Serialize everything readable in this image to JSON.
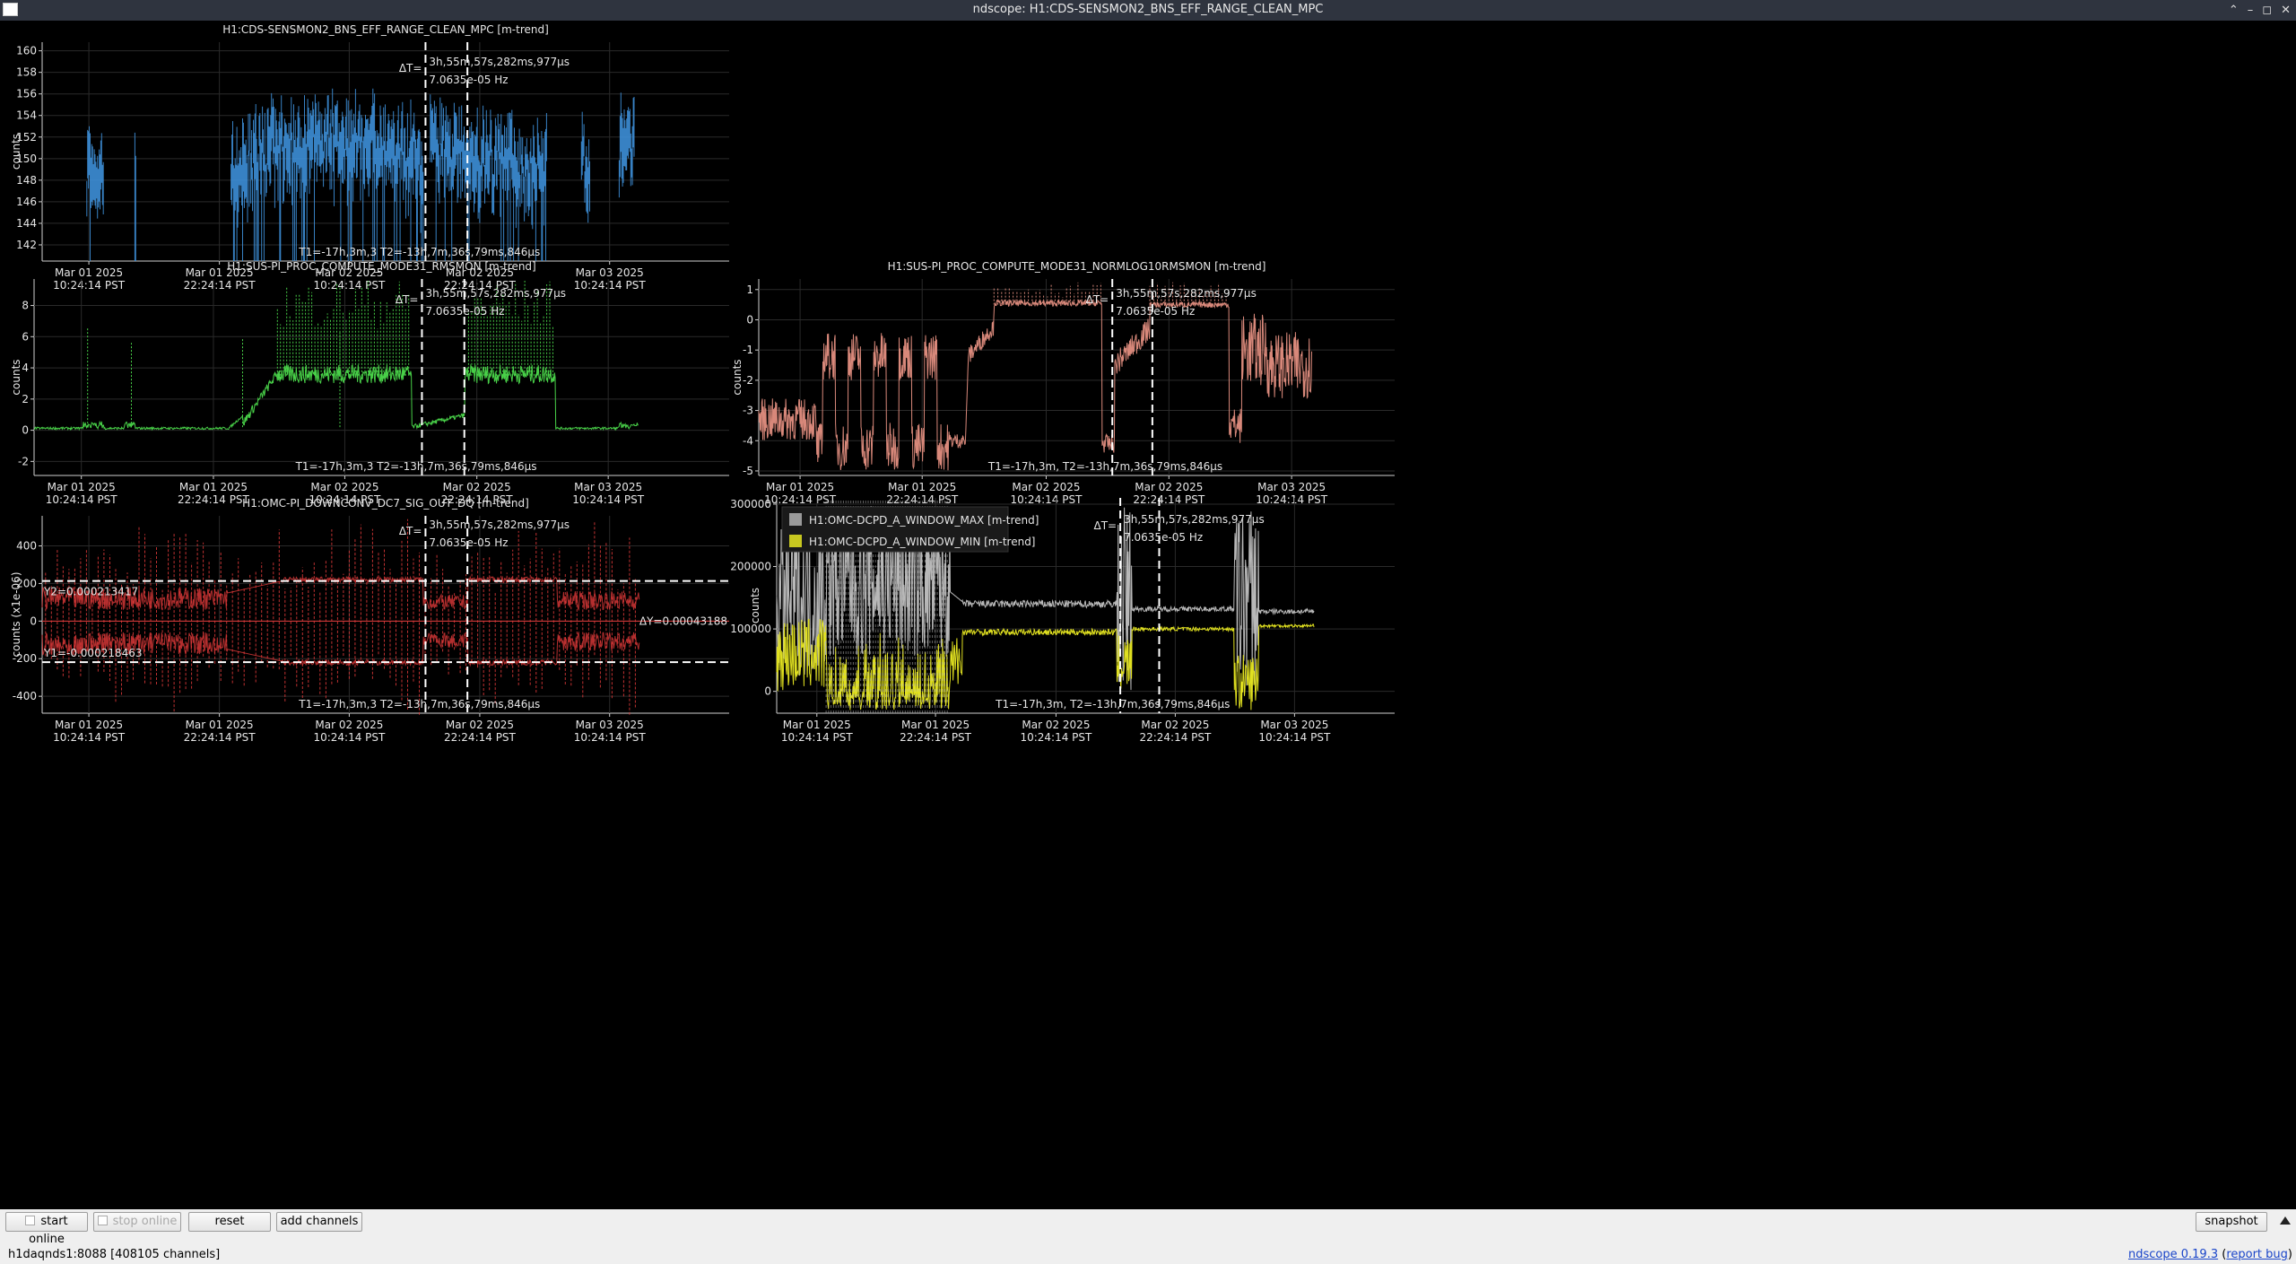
{
  "window": {
    "title": "ndscope: H1:CDS-SENSMON2_BNS_EFF_RANGE_CLEAN_MPC",
    "controls": [
      "⌃",
      "–",
      "◻",
      "✕"
    ]
  },
  "colors": {
    "blue": "#3d8fd8",
    "green": "#48d048",
    "salmon": "#d8887a",
    "red": "#e03a3a",
    "gray": "#b8b8b8",
    "yellow": "#e0e020",
    "cursor": "#ffffff"
  },
  "cursors": {
    "dt": "3h,55m,57s,282ms,977μs",
    "freq": "7.0635e-05 Hz",
    "dt_label": "ΔT=",
    "t_readout": "T1=-17h,3m,3 T2=-13h,7m,36s,79ms,846μs",
    "t_readout_short": "T1=-17h,3m, T2=-13h,7m,36s,79ms,846μs"
  },
  "time_ticks": [
    {
      "date": "Mar 01 2025",
      "time": "10:24:14 PST"
    },
    {
      "date": "Mar 01 2025",
      "time": "22:24:14 PST"
    },
    {
      "date": "Mar 02 2025",
      "time": "10:24:14 PST"
    },
    {
      "date": "Mar 02 2025",
      "time": "22:24:14 PST"
    },
    {
      "date": "Mar 03 2025",
      "time": "10:24:14 PST"
    }
  ],
  "plots": [
    {
      "id": "p1",
      "title": "H1:CDS-SENSMON2_BNS_EFF_RANGE_CLEAN_MPC [m-trend]",
      "ylabel": "counts",
      "yticks": [
        "160",
        "158",
        "156",
        "154",
        "152",
        "150",
        "148",
        "146",
        "144",
        "142"
      ],
      "color": "blue"
    },
    {
      "id": "p2",
      "title": "H1:SUS-PI_PROC_COMPUTE_MODE31_RMSMON [m-trend]",
      "ylabel": "counts",
      "yticks": [
        "8",
        "6",
        "4",
        "2",
        "0",
        "-2"
      ],
      "color": "green"
    },
    {
      "id": "p3",
      "title": "H1:SUS-PI_PROC_COMPUTE_MODE31_NORMLOG10RMSMON [m-trend]",
      "ylabel": "counts",
      "yticks": [
        "1",
        "0",
        "-1",
        "-2",
        "-3",
        "-4",
        "-5"
      ],
      "color": "salmon"
    },
    {
      "id": "p4",
      "title": "H1:OMC-PI_DOWNCONV_DC7_SIG_OUT_DQ [m-trend]",
      "ylabel": "counts (x1e-06)",
      "yticks": [
        "400",
        "200",
        "0",
        "-200",
        "-400"
      ],
      "color": "red",
      "y1": "Y1=-0.000218463",
      "y2": "Y2=0.000213417",
      "dy": "ΔY=0.00043188"
    },
    {
      "id": "p5",
      "title": "",
      "ylabel": "counts",
      "yticks": [
        "300000",
        "200000",
        "100000",
        "0"
      ],
      "color": "yellow",
      "legend": [
        {
          "name": "H1:OMC-DCPD_A_WINDOW_MAX [m-trend]",
          "color": "#9a9a9a"
        },
        {
          "name": "H1:OMC-DCPD_A_WINDOW_MIN [m-trend]",
          "color": "#c8c820"
        }
      ]
    }
  ],
  "bottom": {
    "start_online": "start online",
    "stop_online": "stop online",
    "reset": "reset",
    "add_channels": "add channels",
    "snapshot": "snapshot",
    "status": "h1daqnds1:8088  [408105 channels]",
    "version_link": "ndscope 0.19.3",
    "report_bug": "report bug"
  }
}
